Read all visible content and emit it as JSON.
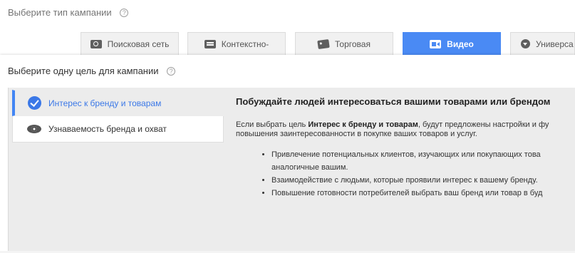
{
  "header": {
    "title": "Выберите тип кампании",
    "help_glyph": "?"
  },
  "campaign_tabs": [
    {
      "label": "Поисковая сеть",
      "icon": "search-icon"
    },
    {
      "label": "Контекстно-",
      "icon": "display-icon"
    },
    {
      "label": "Торговая",
      "icon": "shopping-tag-icon"
    },
    {
      "label": "Видео",
      "icon": "video-icon",
      "active": true
    },
    {
      "label": "Универса",
      "icon": "universal-app-icon"
    }
  ],
  "goal": {
    "title": "Выберите одну цель для кампании",
    "help_glyph": "?",
    "items": [
      {
        "label": "Интерес к бренду и товарам",
        "icon": "check-circle-icon",
        "selected": true
      },
      {
        "label": "Узнаваемость бренда и охват",
        "icon": "eye-icon",
        "selected": false
      }
    ]
  },
  "detail": {
    "heading": "Побуждайте людей интересоваться вашими товарами или брендом",
    "intro_before": "Если выбрать цель ",
    "intro_bold": "Интерес к бренду и товарам",
    "intro_after": ", будут предложены настройки и фу",
    "intro_line2": "повышения заинтересованности в покупке ваших товаров и услуг.",
    "bullets": [
      "Привлечение потенциальных клиентов, изучающих или покупающих това",
      "аналогичные вашим.",
      "Взаимодействие с людьми, которые проявили интерес к вашему бренду.",
      "Повышение готовности потребителей выбрать ваш бренд или товар в буд"
    ]
  },
  "colors": {
    "accent": "#4a8af4",
    "selected_text": "#3b78e7",
    "tab_bg": "#f1f1f1",
    "goal_box_bg": "#ececec"
  }
}
